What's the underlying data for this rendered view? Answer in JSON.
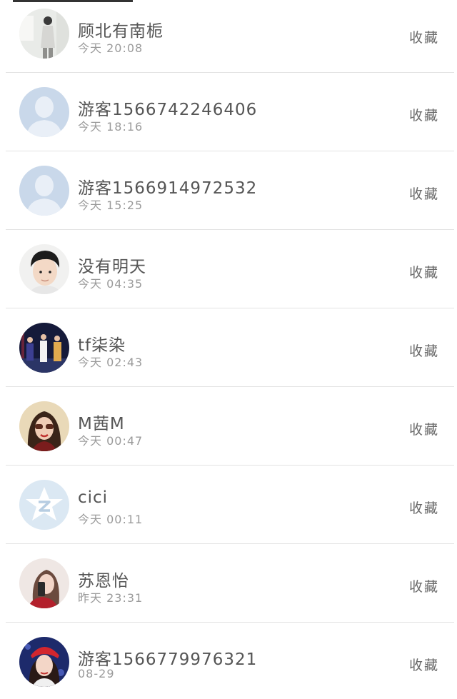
{
  "favorites": {
    "action_label": "收藏",
    "items": [
      {
        "name": "顾北有南栀",
        "time": "今天 20:08",
        "avatar": "photo-person-standing"
      },
      {
        "name": "游客1566742246406",
        "time": "今天 18:16",
        "avatar": "default-silhouette"
      },
      {
        "name": "游客1566914972532",
        "time": "今天 15:25",
        "avatar": "default-silhouette"
      },
      {
        "name": "没有明天",
        "time": "今天 04:35",
        "avatar": "photo-boy-portrait"
      },
      {
        "name": "tf柒染",
        "time": "今天 02:43",
        "avatar": "photo-group-stage"
      },
      {
        "name": "M茜M",
        "time": "今天 00:47",
        "avatar": "photo-girl-sunglasses"
      },
      {
        "name": "cici",
        "time": "今天 00:11",
        "avatar": "qq-star-logo"
      },
      {
        "name": "苏恩怡",
        "time": "昨天 23:31",
        "avatar": "photo-girl-phone"
      },
      {
        "name": "游客1566779976321",
        "time": "08-29",
        "avatar": "photo-girl-red-hat"
      }
    ]
  }
}
